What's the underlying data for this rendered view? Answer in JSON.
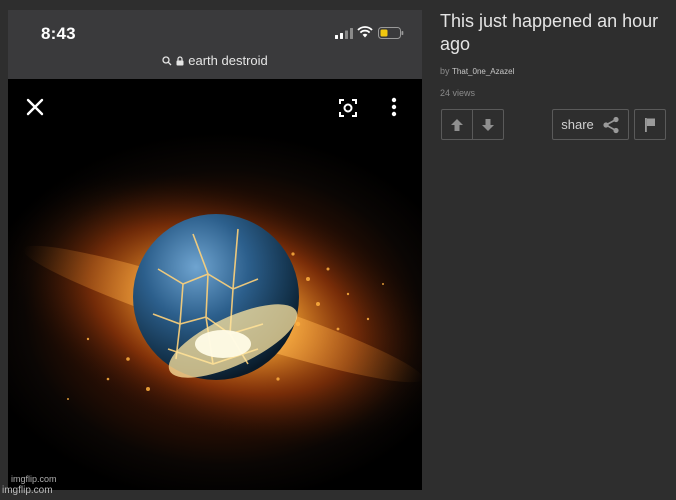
{
  "screenshot": {
    "time": "8:43",
    "url": "earth destroid",
    "watermark": "imgflip.com"
  },
  "post": {
    "title": "This just happened an hour ago",
    "by_label": "by",
    "author": "That_0ne_Azazel",
    "views": "24 views"
  },
  "actions": {
    "share_label": "share"
  },
  "site_watermark": "imgflip.com",
  "colors": {
    "background": "#2e2e2e",
    "title": "#e4e4e4",
    "muted": "#8a8a8a",
    "button_border": "#5a5a5a",
    "battery": "#f2c80f"
  },
  "icons": [
    "close-icon",
    "lens-icon",
    "more-vertical-icon",
    "lock-icon",
    "search-icon",
    "upvote-icon",
    "downvote-icon",
    "share-icon",
    "flag-icon"
  ]
}
